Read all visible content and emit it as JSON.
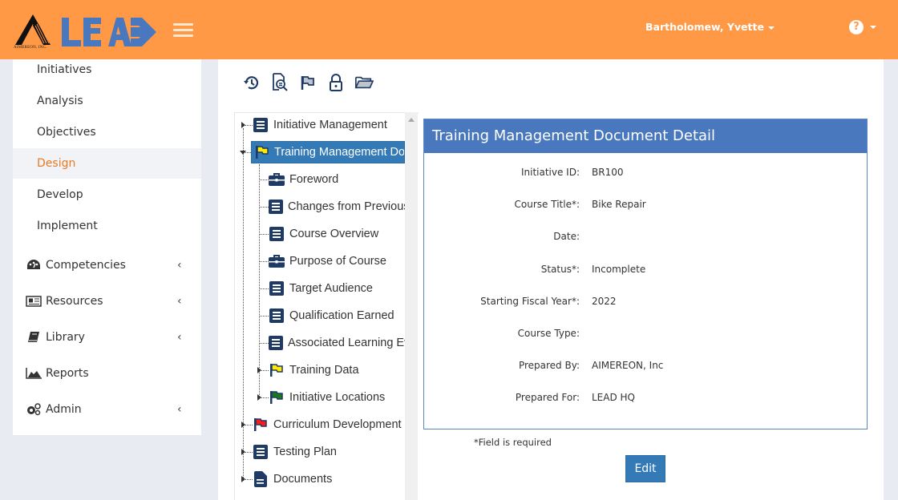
{
  "header": {
    "brand": "LEAD",
    "company": "AIMEREON, INC.",
    "user_name": "Bartholomew, Yvette",
    "help_label": "?"
  },
  "colors": {
    "topbar": "#ff9946",
    "brand_blue": "#4a78be",
    "active_nav": "#e87a23",
    "selected_node": "#337ab7",
    "icon_navy": "#1f3a64"
  },
  "sidebar": {
    "sub_items": [
      {
        "label": "Initiatives"
      },
      {
        "label": "Analysis"
      },
      {
        "label": "Objectives"
      },
      {
        "label": "Design",
        "active": true
      },
      {
        "label": "Develop"
      },
      {
        "label": "Implement"
      }
    ],
    "main_items": [
      {
        "label": "Competencies",
        "icon": "dashboard-icon",
        "expandable": true
      },
      {
        "label": "Resources",
        "icon": "newspaper-icon",
        "expandable": true
      },
      {
        "label": "Library",
        "icon": "book-icon",
        "expandable": true
      },
      {
        "label": "Reports",
        "icon": "area-chart-icon",
        "expandable": false
      },
      {
        "label": "Admin",
        "icon": "gears-icon",
        "expandable": true
      }
    ],
    "chevron": "‹"
  },
  "toolbar": {
    "icons": [
      "history-icon",
      "search-document-icon",
      "flag-icon",
      "lock-icon",
      "folder-open-icon"
    ]
  },
  "tree": {
    "nodes": [
      {
        "label": "Initiative Management",
        "icon": "list-icon",
        "level": 0,
        "state": "collapsed"
      },
      {
        "label": "Training Management Document",
        "icon": "yellow-flag-icon",
        "level": 0,
        "state": "expanded",
        "selected": true
      },
      {
        "label": "Foreword",
        "icon": "briefcase-icon",
        "level": 1
      },
      {
        "label": "Changes from Previous",
        "icon": "list-icon",
        "level": 1
      },
      {
        "label": "Course Overview",
        "icon": "list-icon",
        "level": 1
      },
      {
        "label": "Purpose of Course",
        "icon": "briefcase-icon",
        "level": 1
      },
      {
        "label": "Target Audience",
        "icon": "list-icon",
        "level": 1
      },
      {
        "label": "Qualification Earned",
        "icon": "list-icon",
        "level": 1
      },
      {
        "label": "Associated Learning Events",
        "icon": "list-icon",
        "level": 1
      },
      {
        "label": "Training Data",
        "icon": "yellow-flag-icon",
        "level": 1,
        "state": "collapsed"
      },
      {
        "label": "Initiative Locations",
        "icon": "green-flag-icon",
        "level": 1,
        "state": "collapsed"
      },
      {
        "label": "Curriculum Development",
        "icon": "red-flag-icon",
        "level": 0,
        "state": "collapsed"
      },
      {
        "label": "Testing Plan",
        "icon": "list-icon",
        "level": 0,
        "state": "collapsed"
      },
      {
        "label": "Documents",
        "icon": "file-icon",
        "level": 0,
        "state": "collapsed"
      }
    ]
  },
  "detail": {
    "title": "Training Management Document Detail",
    "fields": [
      {
        "label": "Initiative ID:",
        "value": "BR100"
      },
      {
        "label": "Course Title*:",
        "value": "Bike Repair"
      },
      {
        "label": "Date:",
        "value": ""
      },
      {
        "label": "Status*:",
        "value": "Incomplete"
      },
      {
        "label": "Starting Fiscal Year*:",
        "value": "2022"
      },
      {
        "label": "Course Type:",
        "value": ""
      },
      {
        "label": "Prepared By:",
        "value": "AIMEREON, Inc"
      },
      {
        "label": "Prepared For:",
        "value": "LEAD HQ"
      }
    ],
    "required_note": "*Field is required",
    "edit_label": "Edit"
  }
}
